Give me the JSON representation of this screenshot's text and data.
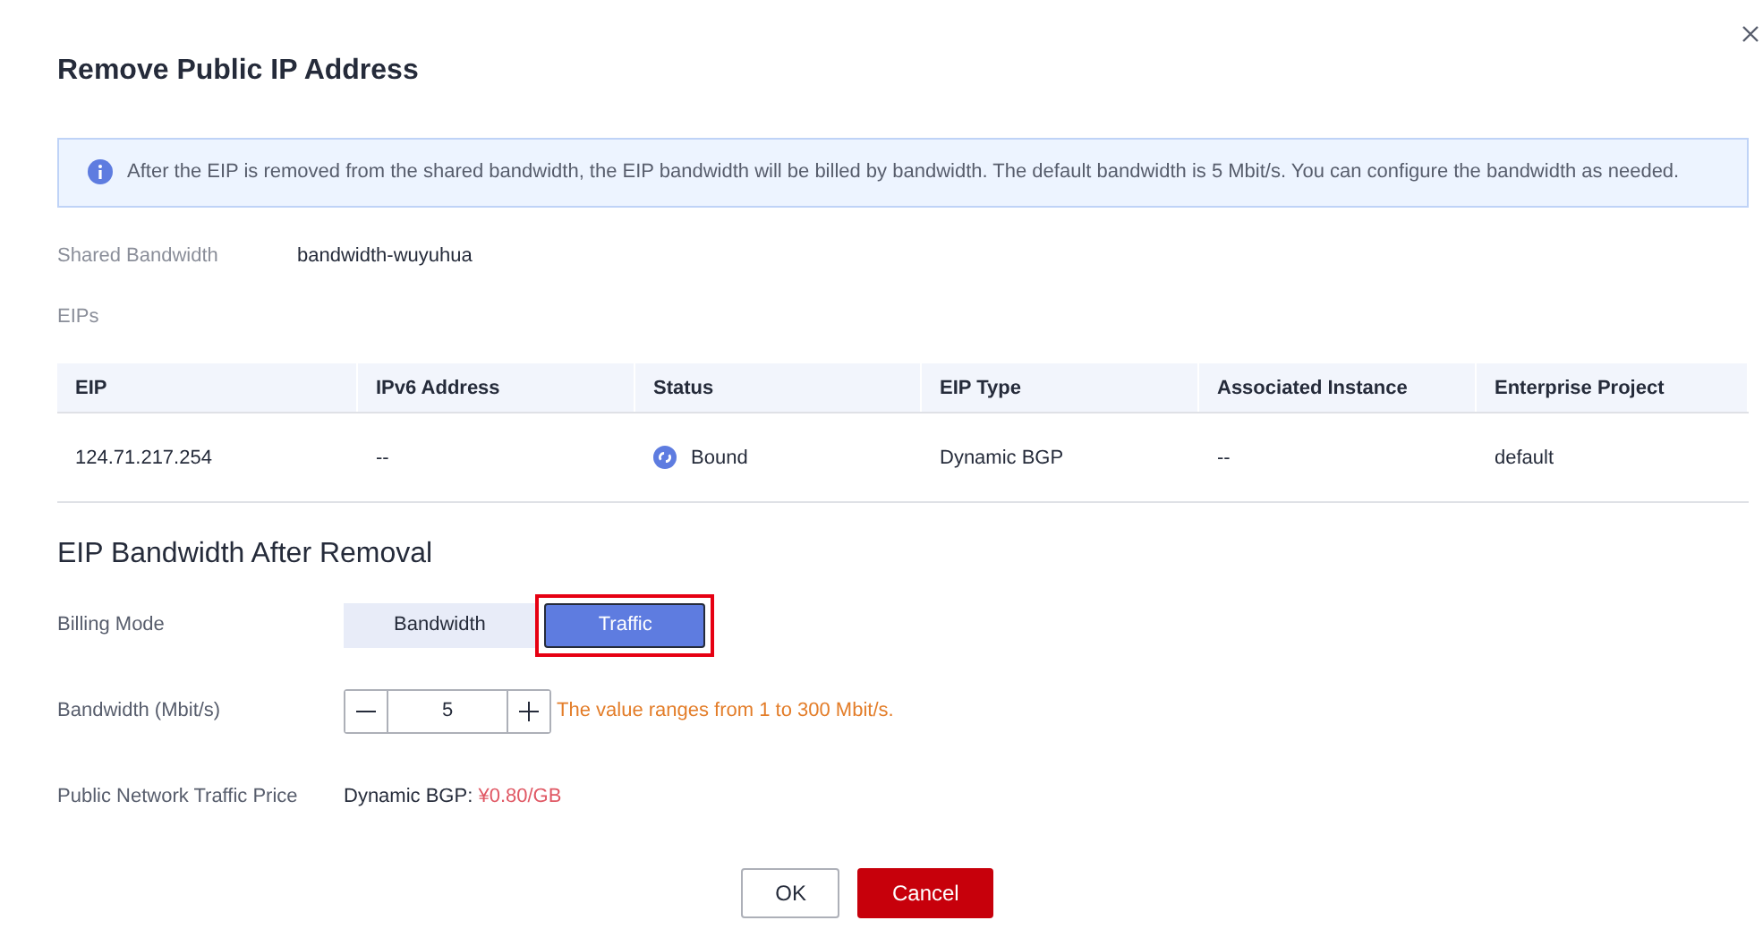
{
  "dialog": {
    "title": "Remove Public IP Address"
  },
  "notice": {
    "text": "After the EIP is removed from the shared bandwidth, the EIP bandwidth will be billed by bandwidth. The default bandwidth is 5 Mbit/s. You can configure the bandwidth as needed."
  },
  "shared_bandwidth": {
    "label": "Shared Bandwidth",
    "value": "bandwidth-wuyuhua"
  },
  "eips_label": "EIPs",
  "table": {
    "columns": [
      "EIP",
      "IPv6 Address",
      "Status",
      "EIP Type",
      "Associated Instance",
      "Enterprise Project"
    ],
    "rows": [
      {
        "cells": [
          "124.71.217.254",
          "--",
          "Bound",
          "Dynamic BGP",
          "--",
          "default"
        ]
      }
    ]
  },
  "section_title": "EIP Bandwidth After Removal",
  "billing_mode": {
    "label": "Billing Mode",
    "options": [
      {
        "label": "Bandwidth",
        "selected": false,
        "highlighted": false
      },
      {
        "label": "Traffic",
        "selected": true,
        "highlighted": true
      }
    ]
  },
  "bandwidth": {
    "label": "Bandwidth (Mbit/s)",
    "value": "5",
    "hint": "The value ranges from 1 to 300 Mbit/s."
  },
  "traffic_price": {
    "label": "Public Network Traffic Price",
    "type": "Dynamic BGP:",
    "price": "¥0.80/GB"
  },
  "buttons": [
    {
      "label": "OK",
      "kind": "secondary"
    },
    {
      "label": "Cancel",
      "kind": "primary"
    }
  ]
}
